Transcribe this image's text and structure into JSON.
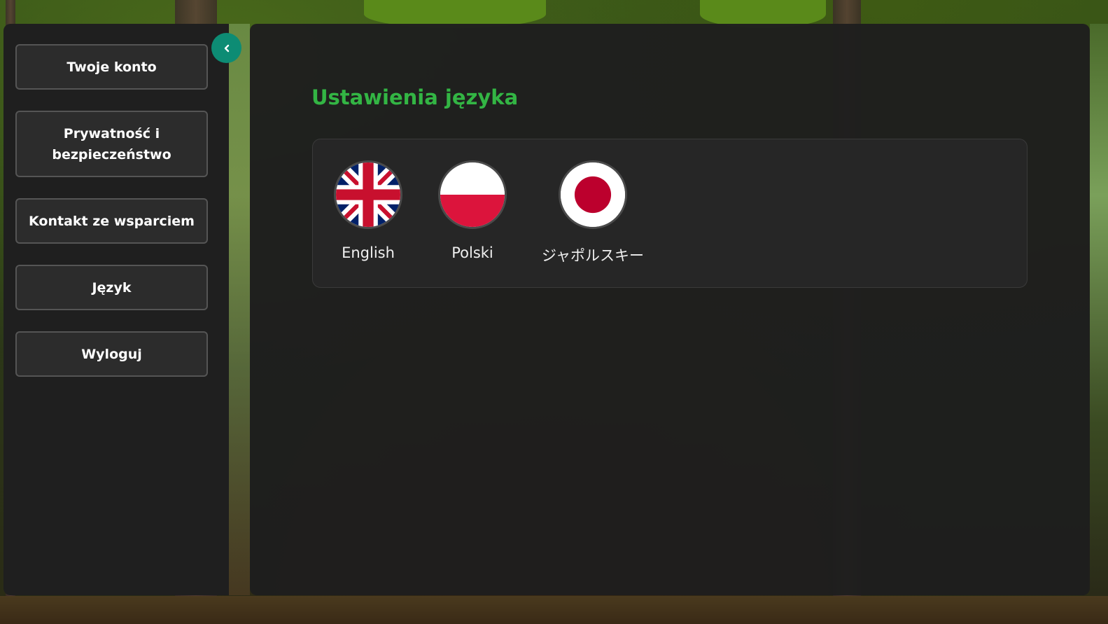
{
  "sidebar": {
    "collapse_label": "‹",
    "items": [
      {
        "label": "Twoje konto"
      },
      {
        "label": "Prywatność i bezpieczeństwo"
      },
      {
        "label": "Kontakt ze wsparciem"
      },
      {
        "label": "Język"
      },
      {
        "label": "Wyloguj"
      }
    ]
  },
  "main": {
    "title": "Ustawienia języka",
    "languages": [
      {
        "label": "English",
        "flag": "uk-flag-icon"
      },
      {
        "label": "Polski",
        "flag": "poland-flag-icon"
      },
      {
        "label": "ジャポルスキー",
        "flag": "japan-flag-icon"
      }
    ]
  },
  "colors": {
    "accent_green": "#33b544",
    "collapse_button": "#0d8c74",
    "panel": "#1f1f1f"
  }
}
